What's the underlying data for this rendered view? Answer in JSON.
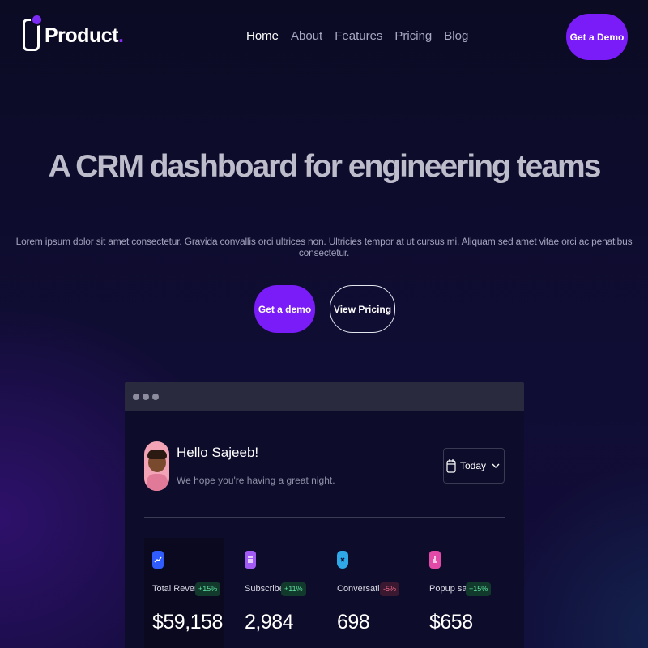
{
  "header": {
    "brand": "Product",
    "brand_accent": ".",
    "nav": [
      {
        "label": "Home",
        "active": true
      },
      {
        "label": "About",
        "active": false
      },
      {
        "label": "Features",
        "active": false
      },
      {
        "label": "Pricing",
        "active": false
      },
      {
        "label": "Blog",
        "active": false
      }
    ],
    "cta_label": "Get a Demo"
  },
  "hero": {
    "title": "A CRM dashboard for engineering teams",
    "subtitle": "Lorem ipsum dolor sit amet consectetur. Gravida convallis orci ultrices non. Ultricies tempor at ut cursus mi. Aliquam sed amet vitae orci ac penatibus consectetur.",
    "primary_button": "Get a demo",
    "secondary_button": "View Pricing"
  },
  "dashboard": {
    "greeting": "Hello Sajeeb!",
    "greeting_sub": "We hope you're having a great night.",
    "date_filter": "Today",
    "stats": [
      {
        "label": "Total Revenue",
        "change": "+15%",
        "trend": "up",
        "value": "$59,158",
        "icon": "chart-trend-icon",
        "color": "#2f5bff"
      },
      {
        "label": "Subscribers",
        "change": "+11%",
        "trend": "up",
        "value": "2,984",
        "icon": "list-icon",
        "color": "#a25cf5"
      },
      {
        "label": "Conversations",
        "change": "-5%",
        "trend": "down",
        "value": "698",
        "icon": "shield-x-icon",
        "color": "#2fa8e8"
      },
      {
        "label": "Popup sales",
        "change": "+15%",
        "trend": "up",
        "value": "$658",
        "icon": "bar-chart-icon",
        "color": "#e34aa8"
      }
    ]
  },
  "colors": {
    "accent": "#7a1cf7",
    "background": "#0b0b24",
    "positive": "#5fe0a0",
    "negative": "#f06b8b"
  }
}
